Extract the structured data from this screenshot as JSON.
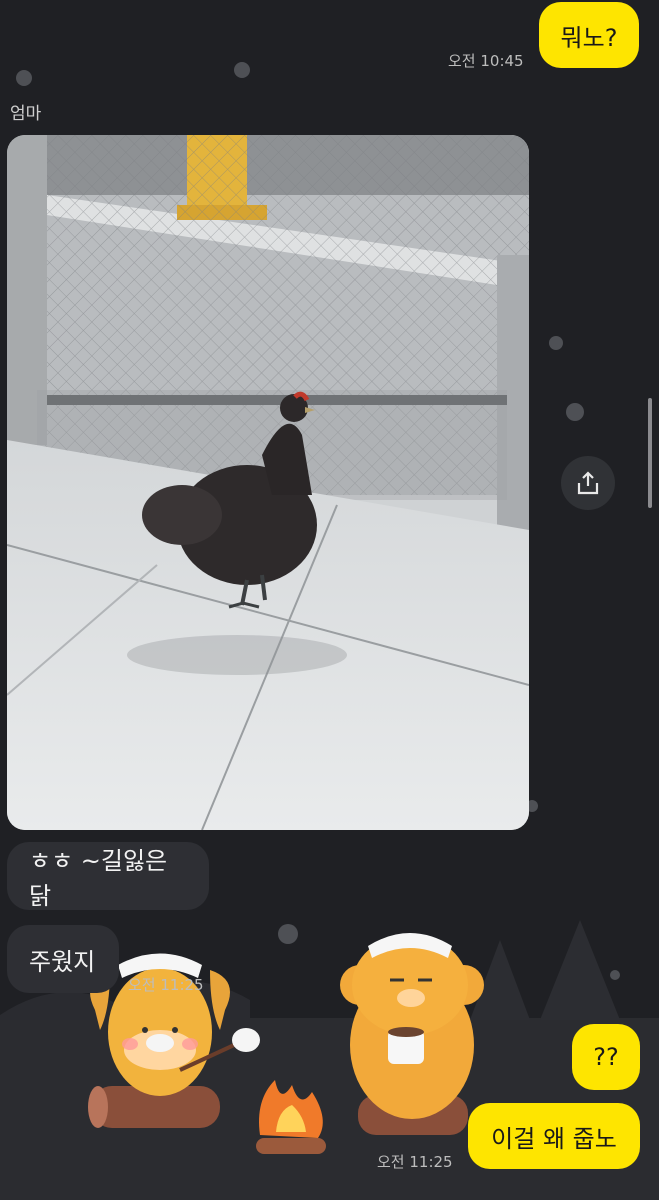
{
  "messages": {
    "out1": {
      "text": "뭐노?",
      "time": "오전 10:45"
    },
    "sender": "엄마",
    "in1": "ㅎㅎ ~길잃은닭",
    "in2": "주웠지",
    "in2_time": "오전 11:25",
    "out2": "??",
    "out3": "이걸 왜 줍노",
    "out3_time": "오전 11:25"
  },
  "icons": {
    "share": "share-icon"
  },
  "colors": {
    "background": "#1f2024",
    "outgoing_bubble": "#fee500",
    "incoming_bubble": "#2e2f34"
  }
}
